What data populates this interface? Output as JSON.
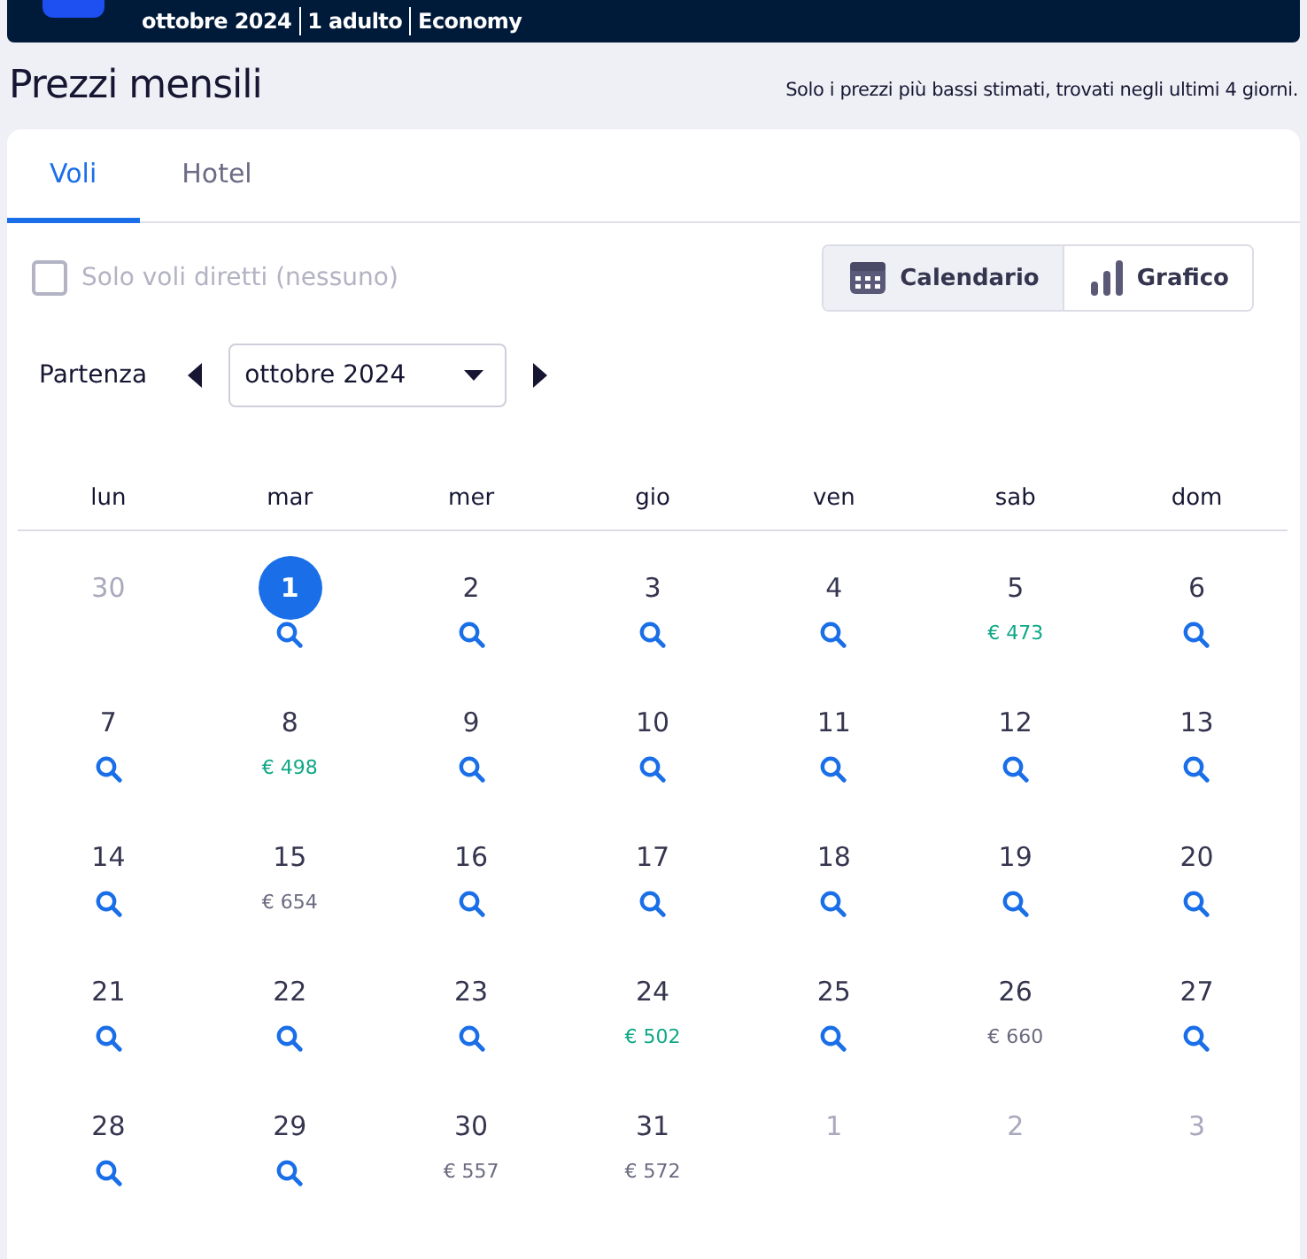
{
  "top_bar": {
    "segments": [
      "ottobre 2024",
      "1 adulto",
      "Economy"
    ]
  },
  "title": "Prezzi mensili",
  "note": "Solo i prezzi più bassi stimati, trovati negli ultimi 4 giorni.",
  "tabs": [
    {
      "label": "Voli",
      "selected": true
    },
    {
      "label": "Hotel",
      "selected": false
    }
  ],
  "direct_filter": {
    "label": "Solo voli diretti (nessuno)",
    "checked": false,
    "disabled": true
  },
  "view_toggle": [
    {
      "label": "Calendario",
      "kind": "calendar",
      "selected": true
    },
    {
      "label": "Grafico",
      "kind": "chart",
      "selected": false
    }
  ],
  "departure": {
    "label": "Partenza",
    "month": "ottobre 2024"
  },
  "weekdays": [
    "lun",
    "mar",
    "mer",
    "gio",
    "ven",
    "sab",
    "dom"
  ],
  "days": [
    {
      "day": "30",
      "outside": true,
      "selected": false,
      "kind": "none"
    },
    {
      "day": "1",
      "outside": false,
      "selected": true,
      "kind": "search"
    },
    {
      "day": "2",
      "outside": false,
      "selected": false,
      "kind": "search"
    },
    {
      "day": "3",
      "outside": false,
      "selected": false,
      "kind": "search"
    },
    {
      "day": "4",
      "outside": false,
      "selected": false,
      "kind": "search"
    },
    {
      "day": "5",
      "outside": false,
      "selected": false,
      "kind": "price",
      "price": "€ 473",
      "cheap": true
    },
    {
      "day": "6",
      "outside": false,
      "selected": false,
      "kind": "search"
    },
    {
      "day": "7",
      "outside": false,
      "selected": false,
      "kind": "search"
    },
    {
      "day": "8",
      "outside": false,
      "selected": false,
      "kind": "price",
      "price": "€ 498",
      "cheap": true
    },
    {
      "day": "9",
      "outside": false,
      "selected": false,
      "kind": "search"
    },
    {
      "day": "10",
      "outside": false,
      "selected": false,
      "kind": "search"
    },
    {
      "day": "11",
      "outside": false,
      "selected": false,
      "kind": "search"
    },
    {
      "day": "12",
      "outside": false,
      "selected": false,
      "kind": "search"
    },
    {
      "day": "13",
      "outside": false,
      "selected": false,
      "kind": "search"
    },
    {
      "day": "14",
      "outside": false,
      "selected": false,
      "kind": "search"
    },
    {
      "day": "15",
      "outside": false,
      "selected": false,
      "kind": "price",
      "price": "€ 654",
      "cheap": false
    },
    {
      "day": "16",
      "outside": false,
      "selected": false,
      "kind": "search"
    },
    {
      "day": "17",
      "outside": false,
      "selected": false,
      "kind": "search"
    },
    {
      "day": "18",
      "outside": false,
      "selected": false,
      "kind": "search"
    },
    {
      "day": "19",
      "outside": false,
      "selected": false,
      "kind": "search"
    },
    {
      "day": "20",
      "outside": false,
      "selected": false,
      "kind": "search"
    },
    {
      "day": "21",
      "outside": false,
      "selected": false,
      "kind": "search"
    },
    {
      "day": "22",
      "outside": false,
      "selected": false,
      "kind": "search"
    },
    {
      "day": "23",
      "outside": false,
      "selected": false,
      "kind": "search"
    },
    {
      "day": "24",
      "outside": false,
      "selected": false,
      "kind": "price",
      "price": "€ 502",
      "cheap": true
    },
    {
      "day": "25",
      "outside": false,
      "selected": false,
      "kind": "search"
    },
    {
      "day": "26",
      "outside": false,
      "selected": false,
      "kind": "price",
      "price": "€ 660",
      "cheap": false
    },
    {
      "day": "27",
      "outside": false,
      "selected": false,
      "kind": "search"
    },
    {
      "day": "28",
      "outside": false,
      "selected": false,
      "kind": "search"
    },
    {
      "day": "29",
      "outside": false,
      "selected": false,
      "kind": "search"
    },
    {
      "day": "30",
      "outside": false,
      "selected": false,
      "kind": "price",
      "price": "€ 557",
      "cheap": false
    },
    {
      "day": "31",
      "outside": false,
      "selected": false,
      "kind": "price",
      "price": "€ 572",
      "cheap": false
    },
    {
      "day": "1",
      "outside": true,
      "selected": false,
      "kind": "none"
    },
    {
      "day": "2",
      "outside": true,
      "selected": false,
      "kind": "none"
    },
    {
      "day": "3",
      "outside": true,
      "selected": false,
      "kind": "none"
    }
  ]
}
